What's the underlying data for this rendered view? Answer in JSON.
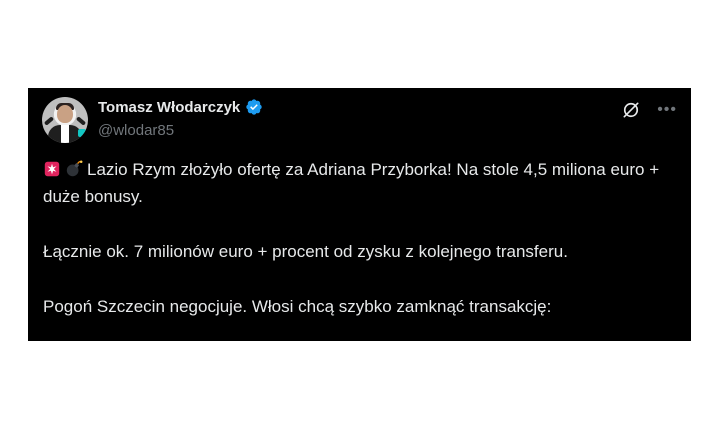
{
  "tweet": {
    "author": {
      "display_name": "Tomasz Włodarczyk",
      "handle": "@wlodar85",
      "verified": true
    },
    "icons": {
      "emoji_1": "police-siren-emoji",
      "emoji_2": "bomb-emoji",
      "grok": "grok-icon",
      "more": "more-icon"
    },
    "paragraphs": [
      "Lazio Rzym złożyło ofertę za Adriana Przyborka! Na stole 4,5 miliona euro + duże bonusy.",
      "Łącznie ok. 7 milionów euro + procent od zysku z kolejnego transferu.",
      "Pogoń Szczecin negocjuje. Włosi chcą szybko zamknąć transakcję:"
    ]
  },
  "colors": {
    "card_bg": "#000000",
    "text": "#e7e9ea",
    "muted": "#71767b",
    "verified": "#1d9bf0"
  }
}
